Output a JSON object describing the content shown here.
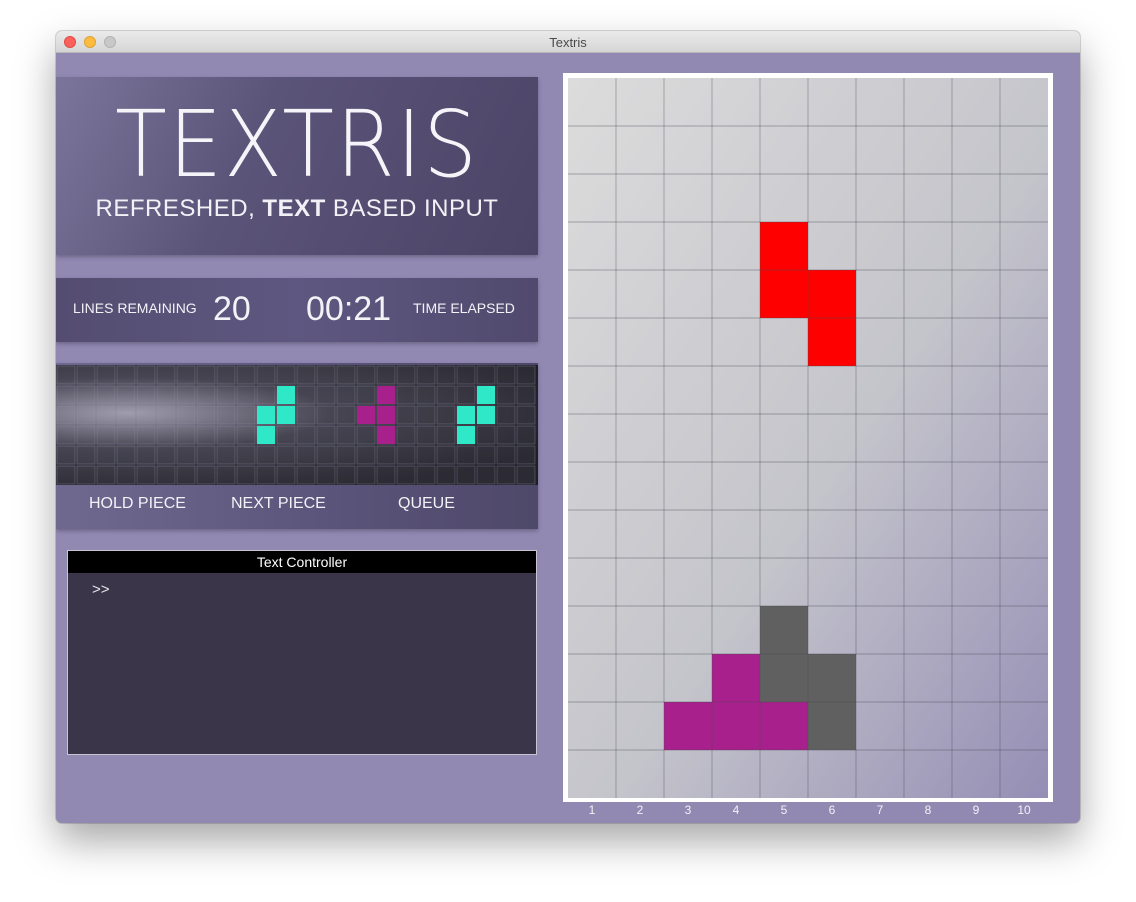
{
  "window": {
    "title": "Textris"
  },
  "logo": {
    "title": "TEXTRIS",
    "sub_pre": "REFRESHED, ",
    "sub_bold": "TEXT",
    "sub_post": " BASED INPUT"
  },
  "stats": {
    "lines_label": "LINES REMAINING",
    "lines_value": "20",
    "time_value": "00:21",
    "time_label": "TIME ELAPSED"
  },
  "preview": {
    "hold_label": "HOLD PIECE",
    "next_label": "NEXT PIECE",
    "queue_label": "QUEUE",
    "colors": {
      "cyan": "#2fe8c8",
      "magenta": "#a8208c"
    },
    "pieces": [
      {
        "slot": "next",
        "color": "cyan",
        "cells": [
          [
            11,
            1
          ],
          [
            10,
            2
          ],
          [
            11,
            2
          ],
          [
            10,
            3
          ]
        ]
      },
      {
        "slot": "queue-1",
        "color": "magenta",
        "cells": [
          [
            16,
            1
          ],
          [
            15,
            2
          ],
          [
            16,
            2
          ],
          [
            16,
            3
          ]
        ]
      },
      {
        "slot": "queue-2",
        "color": "cyan",
        "cells": [
          [
            21,
            1
          ],
          [
            20,
            2
          ],
          [
            21,
            2
          ],
          [
            20,
            3
          ]
        ]
      }
    ]
  },
  "controller": {
    "title": "Text Controller",
    "prompt": ">>",
    "input_value": ""
  },
  "board": {
    "columns": 10,
    "rows": 15,
    "column_labels": [
      "1",
      "2",
      "3",
      "4",
      "5",
      "6",
      "7",
      "8",
      "9",
      "10"
    ],
    "colors": {
      "red": "#ff0000",
      "gray": "#606060",
      "magenta": "#a8208c"
    },
    "active_piece": {
      "color": "red",
      "cells": [
        [
          5,
          4
        ],
        [
          5,
          5
        ],
        [
          6,
          5
        ],
        [
          6,
          6
        ]
      ]
    },
    "locked": [
      {
        "color": "gray",
        "cells": [
          [
            5,
            12
          ],
          [
            5,
            13
          ],
          [
            6,
            13
          ],
          [
            6,
            14
          ]
        ]
      },
      {
        "color": "magenta",
        "cells": [
          [
            4,
            13
          ],
          [
            3,
            14
          ],
          [
            4,
            14
          ],
          [
            5,
            14
          ]
        ]
      }
    ]
  }
}
